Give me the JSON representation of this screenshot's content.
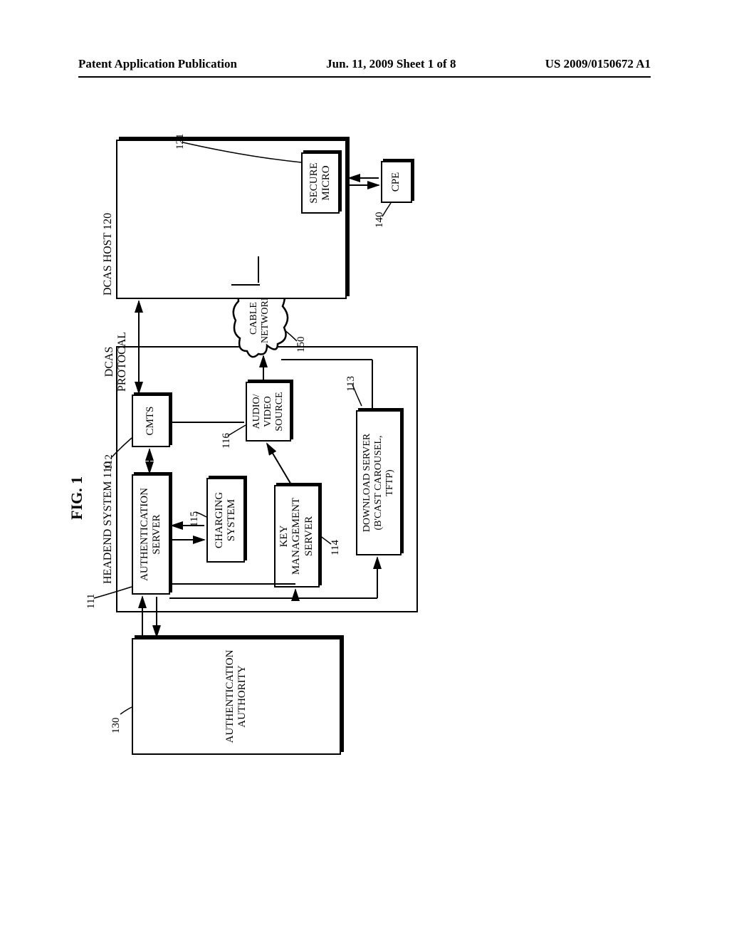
{
  "header": {
    "left": "Patent Application Publication",
    "center": "Jun. 11, 2009  Sheet 1 of 8",
    "right": "US 2009/0150672 A1"
  },
  "figure": {
    "title": "FIG. 1",
    "labels": {
      "headend_system": "HEADEND SYSTEM 110",
      "dcas_host": "DCAS HOST 120",
      "dcas_protocal": "DCAS\nPROTOCAL"
    },
    "blocks": {
      "auth_authority": "AUTHENTICATION\nAUTHORITY",
      "auth_server": "AUTHENTICATION\nSERVER",
      "cmts": "CMTS",
      "charging": "CHARGING\nSYSTEM",
      "key_mgmt": "KEY\nMANAGEMENT\nSERVER",
      "av_source": "AUDIO/\nVIDEO\nSOURCE",
      "download_server": "DOWNLOAD SERVER\n(B'CAST CAROUSEL,\nTFTP)",
      "cable_network": "CABLE\nNETWORK",
      "secure_micro": "SECURE\nMICRO",
      "cpe": "CPE"
    },
    "refs": {
      "r130": "130",
      "r111": "111",
      "r112": "112",
      "r115": "115",
      "r116": "116",
      "r114": "114",
      "r113": "113",
      "r150": "150",
      "r140": "140",
      "r121": "121"
    }
  }
}
